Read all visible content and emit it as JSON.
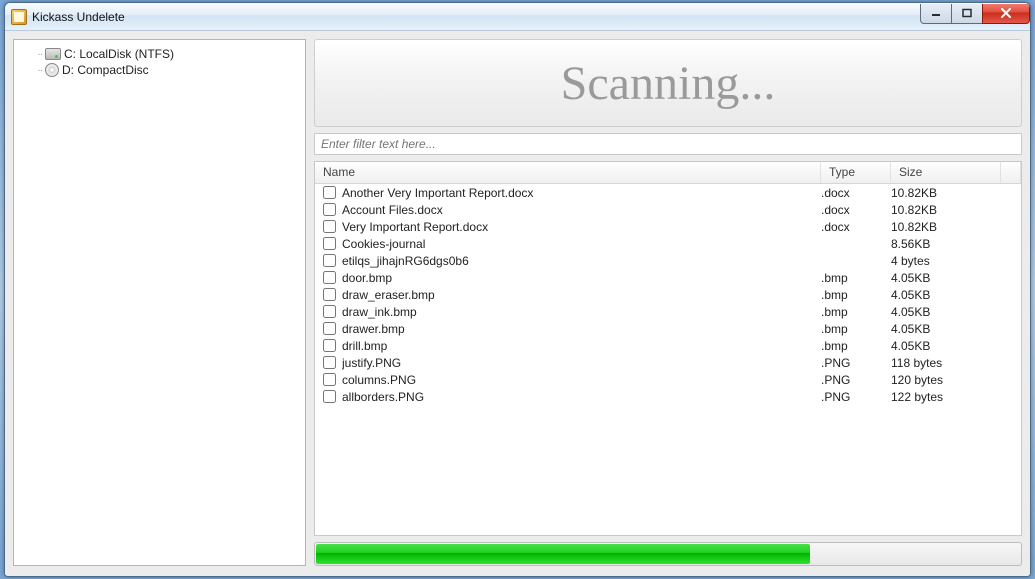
{
  "window": {
    "title": "Kickass Undelete"
  },
  "drives": [
    {
      "label": "C: LocalDisk (NTFS)",
      "icon": "hdd"
    },
    {
      "label": "D: CompactDisc",
      "icon": "cd"
    }
  ],
  "banner": {
    "text": "Scanning..."
  },
  "filter": {
    "placeholder": "Enter filter text here..."
  },
  "columns": {
    "name": "Name",
    "type": "Type",
    "size": "Size"
  },
  "rows": [
    {
      "name": "Another Very Important Report.docx",
      "type": ".docx",
      "size": "10.82KB"
    },
    {
      "name": "Account Files.docx",
      "type": ".docx",
      "size": "10.82KB"
    },
    {
      "name": "Very Important Report.docx",
      "type": ".docx",
      "size": "10.82KB"
    },
    {
      "name": "Cookies-journal",
      "type": "",
      "size": "8.56KB"
    },
    {
      "name": "etilqs_jihajnRG6dgs0b6",
      "type": "",
      "size": "4 bytes"
    },
    {
      "name": "door.bmp",
      "type": ".bmp",
      "size": "4.05KB"
    },
    {
      "name": "draw_eraser.bmp",
      "type": ".bmp",
      "size": "4.05KB"
    },
    {
      "name": "draw_ink.bmp",
      "type": ".bmp",
      "size": "4.05KB"
    },
    {
      "name": "drawer.bmp",
      "type": ".bmp",
      "size": "4.05KB"
    },
    {
      "name": "drill.bmp",
      "type": ".bmp",
      "size": "4.05KB"
    },
    {
      "name": "justify.PNG",
      "type": ".PNG",
      "size": "118 bytes"
    },
    {
      "name": "columns.PNG",
      "type": ".PNG",
      "size": "120 bytes"
    },
    {
      "name": "allborders.PNG",
      "type": ".PNG",
      "size": "122 bytes"
    }
  ],
  "progress": {
    "percent": 70
  }
}
